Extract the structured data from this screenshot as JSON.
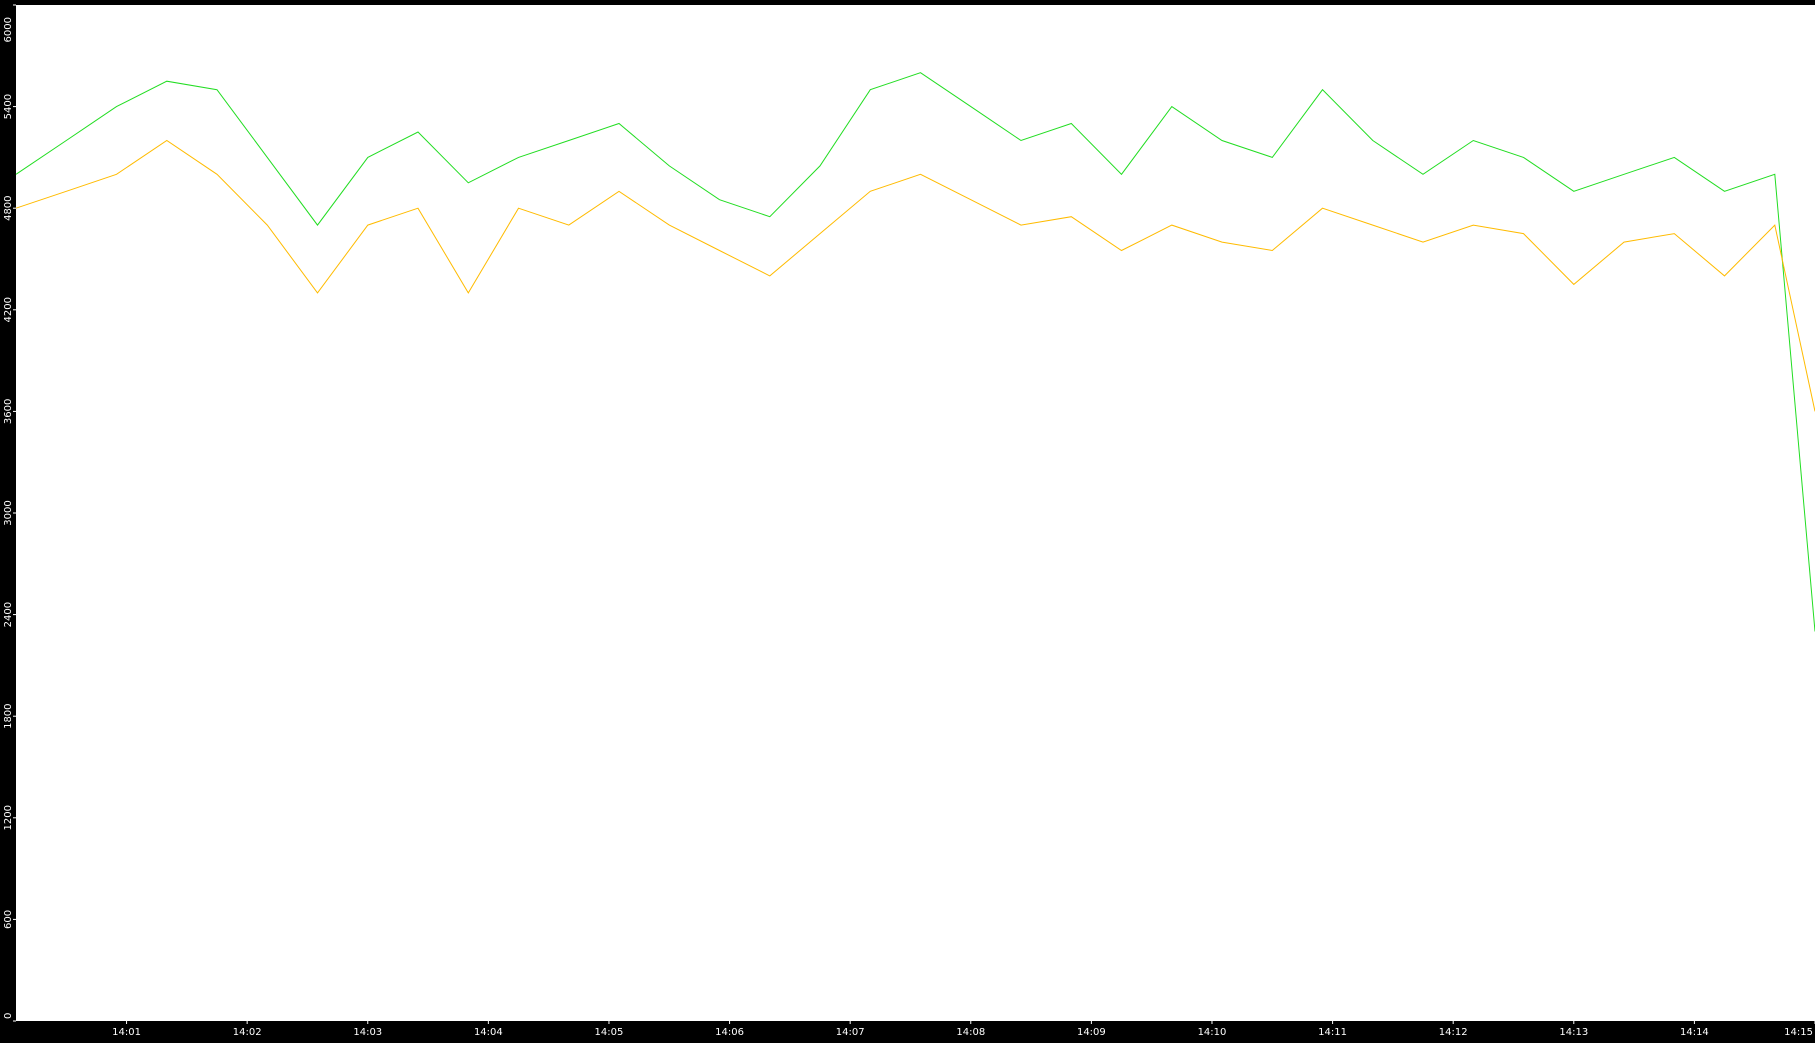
{
  "chart_data": {
    "type": "line",
    "title": "",
    "xlabel": "",
    "ylabel": "",
    "ylim": [
      0,
      6000
    ],
    "xlim": [
      "14:00:05",
      "14:15:00"
    ],
    "y_ticks": [
      "0",
      "600",
      "1200",
      "1800",
      "2400",
      "3000",
      "3600",
      "4200",
      "4800",
      "5400",
      "6000"
    ],
    "x_ticks": [
      "14:01",
      "14:02",
      "14:03",
      "14:04",
      "14:05",
      "14:06",
      "14:07",
      "14:08",
      "14:09",
      "14:10",
      "14:11",
      "14:12",
      "14:13",
      "14:14",
      "14:15"
    ],
    "grid": false,
    "legend": "none",
    "background_color": "#ffffff",
    "frame_color": "#000000",
    "series": [
      {
        "color": "#22dd22",
        "x": [
          "14:00:05",
          "14:00:30",
          "14:00:55",
          "14:01:20",
          "14:01:45",
          "14:02:10",
          "14:02:35",
          "14:03:00",
          "14:03:25",
          "14:03:50",
          "14:04:15",
          "14:04:40",
          "14:05:05",
          "14:05:30",
          "14:05:55",
          "14:06:20",
          "14:06:45",
          "14:07:10",
          "14:07:35",
          "14:08:00",
          "14:08:25",
          "14:08:50",
          "14:09:15",
          "14:09:40",
          "14:10:05",
          "14:10:30",
          "14:10:55",
          "14:11:20",
          "14:11:45",
          "14:12:10",
          "14:12:35",
          "14:13:00",
          "14:13:25",
          "14:13:50",
          "14:14:15",
          "14:14:40",
          "14:15:00"
        ],
        "values": [
          5000,
          5200,
          5400,
          5550,
          5500,
          5100,
          4700,
          5100,
          5250,
          4950,
          5100,
          5200,
          5300,
          5050,
          4850,
          4750,
          5050,
          5500,
          5600,
          5400,
          5200,
          5300,
          5000,
          5400,
          5200,
          5100,
          5500,
          5200,
          5000,
          5200,
          5100,
          4900,
          5000,
          5100,
          4900,
          5000,
          2300
        ]
      },
      {
        "color": "#ffbb00",
        "x": [
          "14:00:05",
          "14:00:30",
          "14:00:55",
          "14:01:20",
          "14:01:45",
          "14:02:10",
          "14:02:35",
          "14:03:00",
          "14:03:25",
          "14:03:50",
          "14:04:15",
          "14:04:40",
          "14:05:05",
          "14:05:30",
          "14:05:55",
          "14:06:20",
          "14:06:45",
          "14:07:10",
          "14:07:35",
          "14:08:00",
          "14:08:25",
          "14:08:50",
          "14:09:15",
          "14:09:40",
          "14:10:05",
          "14:10:30",
          "14:10:55",
          "14:11:20",
          "14:11:45",
          "14:12:10",
          "14:12:35",
          "14:13:00",
          "14:13:25",
          "14:13:50",
          "14:14:15",
          "14:14:40",
          "14:15:00"
        ],
        "values": [
          4800,
          4900,
          5000,
          5200,
          5000,
          4700,
          4300,
          4700,
          4800,
          4300,
          4800,
          4700,
          4900,
          4700,
          4550,
          4400,
          4650,
          4900,
          5000,
          4850,
          4700,
          4750,
          4550,
          4700,
          4600,
          4550,
          4800,
          4700,
          4600,
          4700,
          4650,
          4350,
          4600,
          4650,
          4400,
          4700,
          3600
        ]
      }
    ]
  }
}
